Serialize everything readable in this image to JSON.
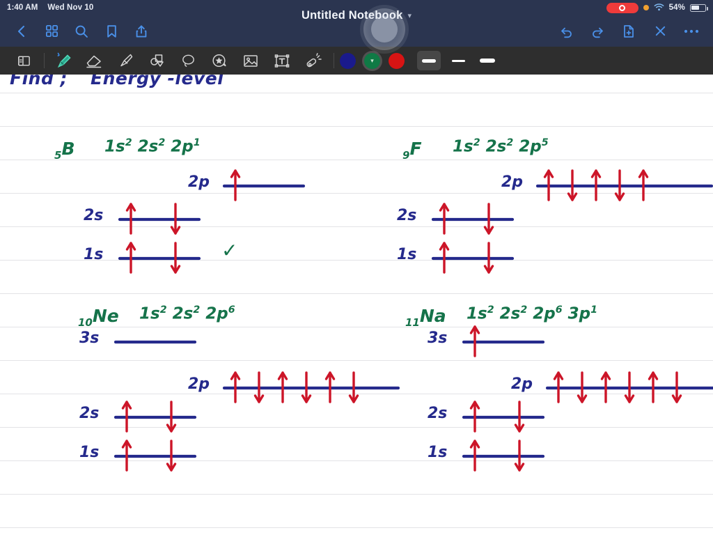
{
  "status_bar": {
    "time": "1:40 AM",
    "date": "Wed Nov 10",
    "battery_percent": "54%",
    "recording_icon": "record-icon",
    "orange_dot_icon": "mic-in-use-dot-icon",
    "wifi_icon": "wifi-icon",
    "battery_icon": "battery-icon",
    "colors": {
      "bar_bg": "#2b3550",
      "record_red": "#ef3b3b",
      "text": "#e8ecf5"
    }
  },
  "nav_bar": {
    "title": "Untitled Notebook",
    "title_chevron": "chevron-down-icon",
    "left_icons": [
      {
        "name": "back-button",
        "label": "Back"
      },
      {
        "name": "thumbnails-button",
        "label": "Page thumbnails"
      },
      {
        "name": "search-button",
        "label": "Search"
      },
      {
        "name": "bookmark-button",
        "label": "Bookmark"
      },
      {
        "name": "share-button",
        "label": "Share"
      }
    ],
    "right_icons": [
      {
        "name": "undo-button",
        "label": "Undo"
      },
      {
        "name": "redo-button",
        "label": "Redo"
      },
      {
        "name": "add-page-button",
        "label": "Add page"
      },
      {
        "name": "close-button",
        "label": "Close"
      },
      {
        "name": "more-button",
        "label": "More"
      }
    ],
    "accent_color": "#4a90e8"
  },
  "tool_bar": {
    "tools": [
      {
        "name": "page-layout-tool",
        "label": "Page layout",
        "selected": false
      },
      {
        "name": "pen-tool",
        "label": "Pen",
        "selected": true
      },
      {
        "name": "eraser-tool",
        "label": "Eraser",
        "selected": false
      },
      {
        "name": "highlighter-tool",
        "label": "Highlighter",
        "selected": false
      },
      {
        "name": "shapes-tool",
        "label": "Shapes",
        "selected": false
      },
      {
        "name": "lasso-tool",
        "label": "Lasso select",
        "selected": false
      },
      {
        "name": "sticker-tool",
        "label": "Sticker",
        "selected": false
      },
      {
        "name": "image-tool",
        "label": "Insert image",
        "selected": false
      },
      {
        "name": "text-box-tool",
        "label": "Text box",
        "selected": false
      },
      {
        "name": "laser-pointer-tool",
        "label": "Laser pointer",
        "selected": false
      }
    ],
    "colors": [
      {
        "name": "color-swatch-navy",
        "hex": "#1a1a8c",
        "selected": false
      },
      {
        "name": "color-swatch-green",
        "hex": "#0f7a45",
        "selected": true
      },
      {
        "name": "color-swatch-red",
        "hex": "#d81414",
        "selected": false
      }
    ],
    "stroke_widths": [
      {
        "name": "stroke-width-thick",
        "selected": true
      },
      {
        "name": "stroke-width-medium",
        "selected": false
      },
      {
        "name": "stroke-width-thin",
        "selected": false
      }
    ],
    "bar_bg": "#2e2e2e",
    "pen_color": "#2fb894"
  },
  "notes": {
    "ink_blue": "#252a8c",
    "ink_green": "#15734a",
    "ink_red": "#cc1528",
    "rule_color": "#e3e3e6",
    "heading": {
      "prefix": "Find ;",
      "text": "Energy -level"
    },
    "elements": [
      {
        "id": "boron",
        "atomic_number": "5",
        "symbol": "B",
        "configuration": "1s² 2s² 2p¹",
        "config_parts": [
          {
            "base": "1s",
            "exp": "2"
          },
          {
            "base": "2s",
            "exp": "2"
          },
          {
            "base": "2p",
            "exp": "1"
          }
        ],
        "orbitals": [
          {
            "label": "2p",
            "boxes": 1,
            "electrons": [
              "up"
            ]
          },
          {
            "label": "2s",
            "boxes": 1,
            "electrons": [
              "up",
              "down"
            ]
          },
          {
            "label": "1s",
            "boxes": 1,
            "electrons": [
              "up",
              "down"
            ]
          }
        ],
        "check_mark": "✓"
      },
      {
        "id": "fluorine",
        "atomic_number": "9",
        "symbol": "F",
        "configuration": "1s² 2s² 2p⁵",
        "config_parts": [
          {
            "base": "1s",
            "exp": "2"
          },
          {
            "base": "2s",
            "exp": "2"
          },
          {
            "base": "2p",
            "exp": "5"
          }
        ],
        "orbitals": [
          {
            "label": "2p",
            "boxes": 3,
            "electrons": [
              "up",
              "down",
              "up",
              "down",
              "up"
            ]
          },
          {
            "label": "2s",
            "boxes": 1,
            "electrons": [
              "up",
              "down"
            ]
          },
          {
            "label": "1s",
            "boxes": 1,
            "electrons": [
              "up",
              "down"
            ]
          }
        ],
        "check_mark": ""
      },
      {
        "id": "neon",
        "atomic_number": "10",
        "symbol": "Ne",
        "configuration": "1s² 2s² 2p⁶",
        "config_parts": [
          {
            "base": "1s",
            "exp": "2"
          },
          {
            "base": "2s",
            "exp": "2"
          },
          {
            "base": "2p",
            "exp": "6"
          }
        ],
        "orbitals": [
          {
            "label": "3s",
            "boxes": 1,
            "electrons": []
          },
          {
            "label": "2p",
            "boxes": 3,
            "electrons": [
              "up",
              "down",
              "up",
              "down",
              "up",
              "down"
            ]
          },
          {
            "label": "2s",
            "boxes": 1,
            "electrons": [
              "up",
              "down"
            ]
          },
          {
            "label": "1s",
            "boxes": 1,
            "electrons": [
              "up",
              "down"
            ]
          }
        ],
        "check_mark": ""
      },
      {
        "id": "sodium",
        "atomic_number": "11",
        "symbol": "Na",
        "configuration": "1s² 2s² 2p⁶ 3p¹",
        "config_parts": [
          {
            "base": "1s",
            "exp": "2"
          },
          {
            "base": "2s",
            "exp": "2"
          },
          {
            "base": "2p",
            "exp": "6"
          },
          {
            "base": "3p",
            "exp": "1"
          }
        ],
        "orbitals": [
          {
            "label": "3s",
            "boxes": 1,
            "electrons": [
              "up"
            ]
          },
          {
            "label": "2p",
            "boxes": 3,
            "electrons": [
              "up",
              "down",
              "up",
              "down",
              "up",
              "down"
            ]
          },
          {
            "label": "2s",
            "boxes": 1,
            "electrons": [
              "up",
              "down"
            ]
          },
          {
            "label": "1s",
            "boxes": 1,
            "electrons": [
              "up",
              "down"
            ]
          }
        ],
        "check_mark": ""
      }
    ]
  }
}
